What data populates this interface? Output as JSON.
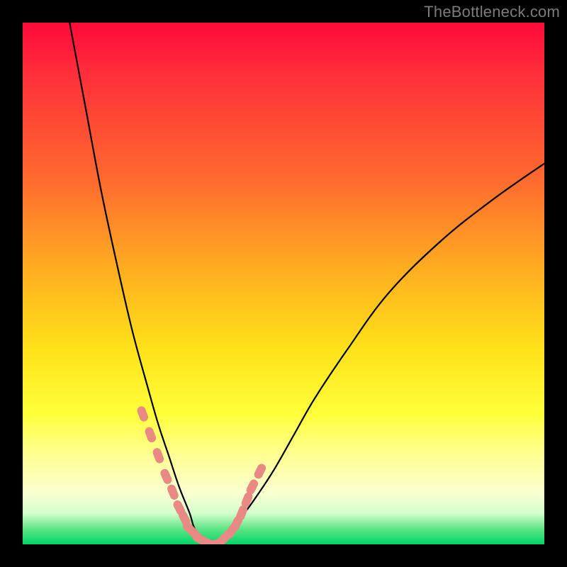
{
  "watermark": "TheBottleneck.com",
  "colors": {
    "frame": "#000000",
    "curve": "#000000",
    "marker": "#e88a83",
    "gradient_top": "#ff0a3a",
    "gradient_bottom": "#00d768"
  },
  "chart_data": {
    "type": "line",
    "title": "",
    "xlabel": "",
    "ylabel": "",
    "xlim": [
      0,
      100
    ],
    "ylim": [
      0,
      100
    ],
    "series": [
      {
        "name": "bottleneck-curve",
        "x": [
          9,
          12,
          15,
          18,
          21,
          24,
          26,
          28,
          30,
          32,
          33,
          35,
          37,
          39,
          41,
          44,
          48,
          52,
          56,
          62,
          70,
          80,
          90,
          100
        ],
        "y": [
          100,
          84,
          68,
          54,
          41,
          30,
          23,
          17,
          11,
          6,
          3,
          1,
          0,
          1,
          4,
          8,
          14,
          21,
          28,
          37,
          48,
          58,
          66,
          73
        ]
      }
    ],
    "markers": {
      "name": "highlight-points",
      "x": [
        23,
        24.5,
        26,
        27.5,
        28.8,
        30,
        31,
        32,
        33,
        34,
        35,
        36,
        37,
        38,
        39,
        40,
        41,
        42,
        43,
        44,
        45.5
      ],
      "y": [
        25,
        21,
        17,
        13,
        10,
        7,
        5,
        3,
        2,
        1,
        0.5,
        0,
        0,
        0.5,
        1.5,
        2.5,
        4,
        6,
        8.5,
        11,
        14
      ]
    }
  }
}
